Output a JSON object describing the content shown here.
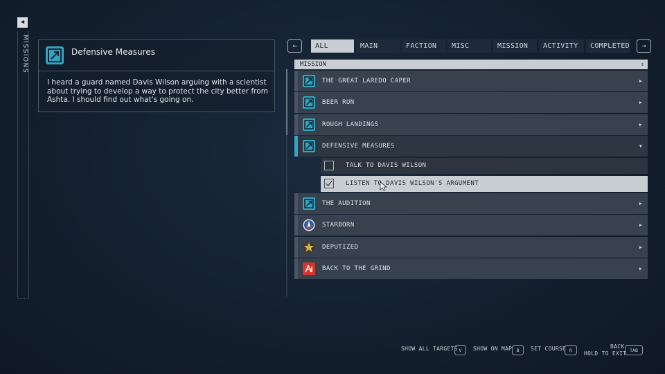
{
  "sidebar": {
    "label": "MISSIONS",
    "collapse_glyph": "◀"
  },
  "detail": {
    "title": "Defensive Measures",
    "description": "I heard a guard named Davis Wilson arguing with a scientist about trying to develop a way to protect the city better from Ashta. I should find out what's going on.",
    "icon": "mission-icon"
  },
  "nav": {
    "prev": "←",
    "next": "→"
  },
  "tabs": [
    "ALL",
    "MAIN",
    "FACTION",
    "MISC",
    "MISSION",
    "ACTIVITY",
    "COMPLETED"
  ],
  "active_tab": "ALL",
  "list_header": {
    "label": "MISSION",
    "sort_glyph": "⇕"
  },
  "missions": [
    {
      "label": "THE GREAT LAREDO CAPER",
      "icon": "mission-icon"
    },
    {
      "label": "BEER RUN",
      "icon": "mission-icon"
    },
    {
      "label": "ROUGH LANDINGS",
      "icon": "mission-icon"
    },
    {
      "label": "DEFENSIVE MEASURES",
      "icon": "mission-icon",
      "expanded": true
    },
    {
      "label": "THE AUDITION",
      "icon": "mission-icon"
    },
    {
      "label": "STARBORN",
      "icon": "starborn-icon"
    },
    {
      "label": "DEPUTIZED",
      "icon": "deputized-badge-icon"
    },
    {
      "label": "BACK TO THE GRIND",
      "icon": "ryujin-icon"
    }
  ],
  "objectives": [
    {
      "label": "TALK TO DAVIS WILSON",
      "checked": false
    },
    {
      "label": "LISTEN TO DAVIS WILSON'S ARGUMENT",
      "checked": true
    }
  ],
  "glyphs": {
    "collapsed": "▶",
    "expanded": "▼"
  },
  "footer": {
    "show_all_targets": "SHOW ALL TARGETS",
    "show_all_key": "V",
    "show_on_map": "SHOW ON MAP",
    "show_on_map_key": "B",
    "set_course": "SET COURSE",
    "set_course_key": "R",
    "back": "BACK",
    "hold_to_exit": "HOLD TO EXIT",
    "back_key": "TAB"
  },
  "colors": {
    "accent": "#2fa6c2",
    "tab_active_bg": "#c9ced2",
    "row_bg": "#38414e"
  }
}
